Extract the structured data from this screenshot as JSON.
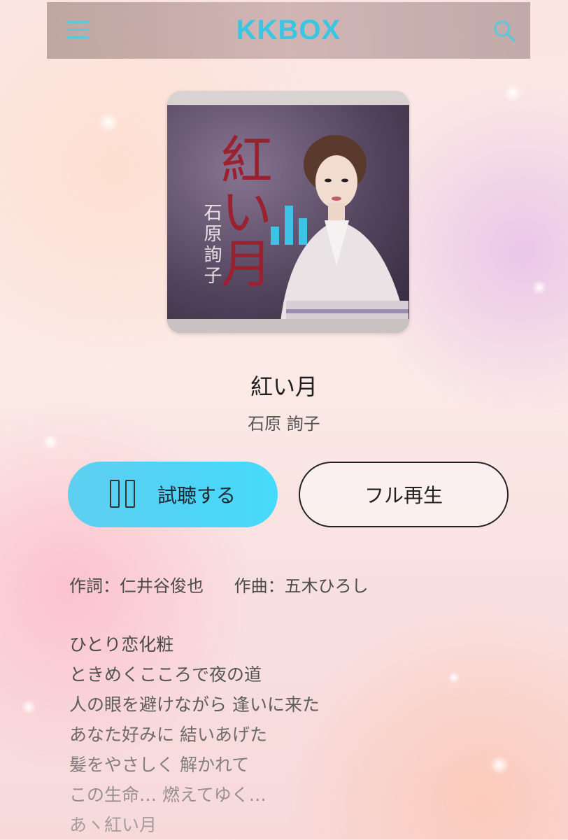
{
  "header": {
    "logo": "KKBOX",
    "menu_icon": "hamburger-menu-icon",
    "search_icon": "search-icon",
    "accent_color": "#38c6e2"
  },
  "album_art": {
    "cover_title": "紅い月",
    "cover_artist": "石原詢子",
    "overlay_icon": "equalizer-icon"
  },
  "song": {
    "title": "紅い月",
    "artist": "石原 詢子"
  },
  "actions": {
    "preview_label": "試聴する",
    "preview_icon": "pause-icon",
    "full_play_label": "フル再生"
  },
  "credits": {
    "lyricist": "作詞：仁井谷俊也",
    "composer": "作曲：五木ひろし"
  },
  "lyrics": [
    "ひとり恋化粧",
    "ときめくこころで夜の道",
    "人の眼を避けながら 逢いに来た",
    "あなた好みに 結いあげた",
    "髪をやさしく 解かれて",
    "この生命… 燃えてゆく…",
    "あヽ紅い月"
  ]
}
